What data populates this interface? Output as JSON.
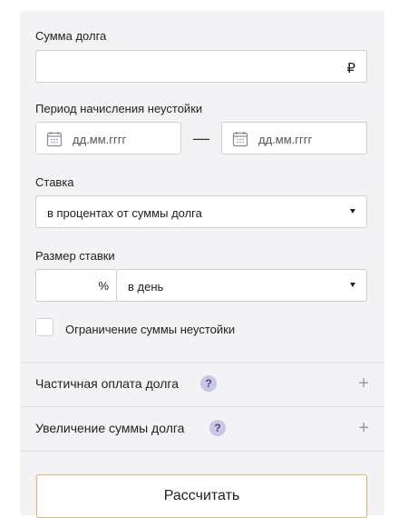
{
  "form": {
    "debt_amount": {
      "label": "Сумма долга",
      "value": "",
      "currency_symbol": "₽"
    },
    "period": {
      "label": "Период начисления неустойки",
      "from_placeholder": "дд.мм.гггг",
      "to_placeholder": "дд.мм.гггг",
      "separator": "—",
      "icon": "calendar-icon"
    },
    "rate": {
      "label": "Ставка",
      "selected": "в процентах от суммы долга"
    },
    "rate_size": {
      "label": "Размер ставки",
      "value": "",
      "percent_sign": "%",
      "period_selected": "в день"
    },
    "limit_checkbox": {
      "label": "Ограничение суммы неустойки",
      "checked": false
    }
  },
  "accordions": [
    {
      "title": "Частичная оплата долга",
      "help": "?",
      "expand": "+"
    },
    {
      "title": "Увеличение суммы долга",
      "help": "?",
      "expand": "+"
    }
  ],
  "actions": {
    "calculate_label": "Рассчитать"
  },
  "colors": {
    "panel_bg": "#f3f3f6",
    "help_badge_bg": "#c9c6ea",
    "button_border": "#e0b47a"
  }
}
